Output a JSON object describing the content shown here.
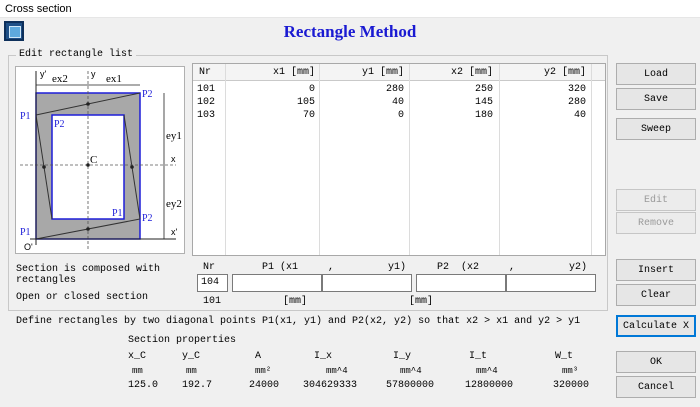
{
  "window": {
    "title": "Cross section",
    "heading": "Rectangle Method"
  },
  "group": {
    "title": "Edit rectangle list"
  },
  "diagram": {
    "labels": {
      "ex2": "ex2",
      "ex1": "ex1",
      "ey1": "ey1",
      "ey2": "ey2",
      "y_axis": "y'",
      "y": "y",
      "x": "x",
      "x_axis": "x'",
      "origin": "O'",
      "center": "C",
      "p1": "P1",
      "p2": "P2"
    }
  },
  "table": {
    "columns": [
      "Nr",
      "x1 [mm]",
      "y1 [mm]",
      "x2 [mm]",
      "y2 [mm]"
    ],
    "rows": [
      {
        "nr": "101",
        "x1": "0",
        "y1": "280",
        "x2": "250",
        "y2": "320"
      },
      {
        "nr": "102",
        "x1": "105",
        "y1": "40",
        "x2": "145",
        "y2": "280"
      },
      {
        "nr": "103",
        "x1": "70",
        "y1": "0",
        "x2": "180",
        "y2": "40"
      }
    ]
  },
  "buttons": {
    "load": "Load",
    "save": "Save",
    "sweep": "Sweep",
    "edit": "Edit",
    "remove": "Remove",
    "insert": "Insert",
    "clear": "Clear",
    "calculate": "Calculate X",
    "ok": "OK",
    "cancel": "Cancel"
  },
  "info": {
    "composed": "Section is composed with rectangles",
    "section_type": "Open or closed section",
    "define": "Define rectangles by two diagonal points P1(x1, y1) and P2(x2, y2) so that x2 > x1 and y2 > y1"
  },
  "entry": {
    "nr_label": "Nr",
    "p1_label": "P1 (x1     ,         y1)",
    "p2_label": "P2  (x2     ,         y2)",
    "nr_value": "104",
    "next_nr": "101",
    "unit1": "[mm]",
    "unit2": "[mm]"
  },
  "properties": {
    "title": "Section properties",
    "headers": [
      "x_C",
      "y_C",
      "A",
      "I_x",
      "I_y",
      "I_t",
      "W_t"
    ],
    "units": [
      "mm",
      "mm",
      "mm²",
      "mm^4",
      "mm^4",
      "mm^4",
      "mm³"
    ],
    "values": [
      "125.0",
      "192.7",
      "24000",
      "304629333",
      "57800000",
      "12800000",
      "320000"
    ]
  }
}
